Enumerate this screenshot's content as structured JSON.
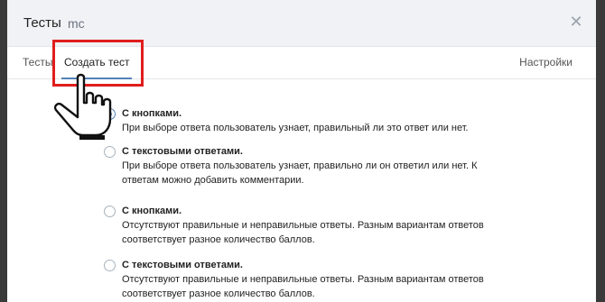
{
  "modal": {
    "title": "Тесты",
    "subtitle": "mc",
    "close_icon": "close-icon"
  },
  "tabs": [
    {
      "label": "Тесты"
    },
    {
      "label": "Создать тест",
      "active": true
    },
    {
      "label": "Настройки"
    }
  ],
  "options": [
    {
      "title": "С кнопками.",
      "selected": true,
      "desc": "При выборе ответа пользователь узнает, правильный ли это ответ или нет."
    },
    {
      "title": "С текстовыми ответами.",
      "selected": false,
      "desc": "При выборе ответа пользователь узнает, правильно ли он ответил или нет. К ответам можно добавить комментарии."
    },
    {
      "title": "С кнопками.",
      "selected": false,
      "desc": "Отсутствуют правильные и неправильные ответы. Разным вариантам ответов соответствует разное количество баллов."
    },
    {
      "title": "С текстовыми ответами.",
      "selected": false,
      "desc": "Отсутствуют правильные и неправильные ответы. Разным вариантам ответов соответствует разное количество баллов."
    }
  ],
  "colors": {
    "accent": "#5181b8",
    "highlight": "#e01d1d"
  },
  "icons": {
    "pointer": "hand-pointer-icon"
  }
}
